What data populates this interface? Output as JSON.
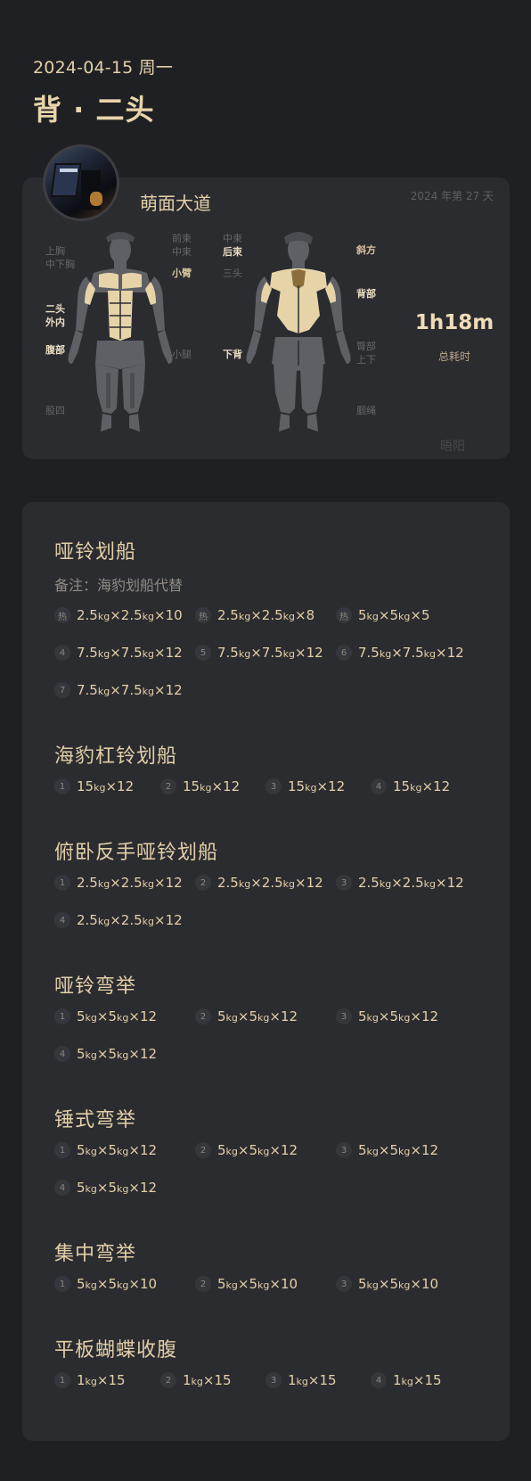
{
  "header": {
    "date": "2024-04-15 周一",
    "title": "背 · 二头"
  },
  "summary": {
    "user_name": "萌面大道",
    "day_count": "2024 年第 27 天",
    "duration": "1h18m",
    "duration_label": "总耗时",
    "watermark": "晤阳",
    "front_labels": [
      {
        "text": "上胸\n中下胸",
        "active": false
      },
      {
        "text": "二头\n外内",
        "active": true
      },
      {
        "text": "腹部",
        "active": true
      },
      {
        "text": "股四",
        "active": false
      },
      {
        "text": "前束\n中束",
        "active": false
      },
      {
        "text": "小臂",
        "active": true
      },
      {
        "text": "小腿",
        "active": false
      }
    ],
    "back_labels": [
      {
        "text": "中束",
        "active": false
      },
      {
        "text": "后束",
        "active": true
      },
      {
        "text": "三头",
        "active": false
      },
      {
        "text": "下背",
        "active": true
      },
      {
        "text": "斜方",
        "active": true
      },
      {
        "text": "背部",
        "active": true
      },
      {
        "text": "臀部\n上下",
        "active": false
      },
      {
        "text": "腘绳",
        "active": false
      }
    ],
    "colors": {
      "accent": "#d8c39e",
      "highlight": "#e6d3a8",
      "muscle": "#5e6066",
      "muscle_dark": "#4a4c52"
    }
  },
  "exercises": [
    {
      "name": "哑铃划船",
      "note": "备注：海豹划船代替",
      "sets": [
        {
          "badge": "热",
          "parts": [
            "2.5",
            "kg",
            "×",
            "2.5",
            "kg",
            "×10"
          ]
        },
        {
          "badge": "热",
          "parts": [
            "2.5",
            "kg",
            "×",
            "2.5",
            "kg",
            "×8"
          ]
        },
        {
          "badge": "热",
          "parts": [
            "5",
            "kg",
            "×",
            "5",
            "kg",
            "×5"
          ]
        },
        {
          "badge": "4",
          "parts": [
            "7.5",
            "kg",
            "×",
            "7.5",
            "kg",
            "×12"
          ]
        },
        {
          "badge": "5",
          "parts": [
            "7.5",
            "kg",
            "×",
            "7.5",
            "kg",
            "×12"
          ]
        },
        {
          "badge": "6",
          "parts": [
            "7.5",
            "kg",
            "×",
            "7.5",
            "kg",
            "×12"
          ]
        },
        {
          "badge": "7",
          "parts": [
            "7.5",
            "kg",
            "×",
            "7.5",
            "kg",
            "×12"
          ]
        }
      ]
    },
    {
      "name": "海豹杠铃划船",
      "note": "",
      "sets": [
        {
          "badge": "1",
          "parts": [
            "15",
            "kg",
            "×12"
          ]
        },
        {
          "badge": "2",
          "parts": [
            "15",
            "kg",
            "×12"
          ]
        },
        {
          "badge": "3",
          "parts": [
            "15",
            "kg",
            "×12"
          ]
        },
        {
          "badge": "4",
          "parts": [
            "15",
            "kg",
            "×12"
          ]
        }
      ]
    },
    {
      "name": "俯卧反手哑铃划船",
      "note": "",
      "sets": [
        {
          "badge": "1",
          "parts": [
            "2.5",
            "kg",
            "×",
            "2.5",
            "kg",
            "×12"
          ]
        },
        {
          "badge": "2",
          "parts": [
            "2.5",
            "kg",
            "×",
            "2.5",
            "kg",
            "×12"
          ]
        },
        {
          "badge": "3",
          "parts": [
            "2.5",
            "kg",
            "×",
            "2.5",
            "kg",
            "×12"
          ]
        },
        {
          "badge": "4",
          "parts": [
            "2.5",
            "kg",
            "×",
            "2.5",
            "kg",
            "×12"
          ]
        }
      ]
    },
    {
      "name": "哑铃弯举",
      "note": "",
      "sets": [
        {
          "badge": "1",
          "parts": [
            "5",
            "kg",
            "×",
            "5",
            "kg",
            "×12"
          ]
        },
        {
          "badge": "2",
          "parts": [
            "5",
            "kg",
            "×",
            "5",
            "kg",
            "×12"
          ]
        },
        {
          "badge": "3",
          "parts": [
            "5",
            "kg",
            "×",
            "5",
            "kg",
            "×12"
          ]
        },
        {
          "badge": "4",
          "parts": [
            "5",
            "kg",
            "×",
            "5",
            "kg",
            "×12"
          ]
        }
      ]
    },
    {
      "name": "锤式弯举",
      "note": "",
      "sets": [
        {
          "badge": "1",
          "parts": [
            "5",
            "kg",
            "×",
            "5",
            "kg",
            "×12"
          ]
        },
        {
          "badge": "2",
          "parts": [
            "5",
            "kg",
            "×",
            "5",
            "kg",
            "×12"
          ]
        },
        {
          "badge": "3",
          "parts": [
            "5",
            "kg",
            "×",
            "5",
            "kg",
            "×12"
          ]
        },
        {
          "badge": "4",
          "parts": [
            "5",
            "kg",
            "×",
            "5",
            "kg",
            "×12"
          ]
        }
      ]
    },
    {
      "name": "集中弯举",
      "note": "",
      "sets": [
        {
          "badge": "1",
          "parts": [
            "5",
            "kg",
            "×",
            "5",
            "kg",
            "×10"
          ]
        },
        {
          "badge": "2",
          "parts": [
            "5",
            "kg",
            "×",
            "5",
            "kg",
            "×10"
          ]
        },
        {
          "badge": "3",
          "parts": [
            "5",
            "kg",
            "×",
            "5",
            "kg",
            "×10"
          ]
        }
      ]
    },
    {
      "name": "平板蝴蝶收腹",
      "note": "",
      "sets": [
        {
          "badge": "1",
          "parts": [
            "1",
            "kg",
            "×15"
          ]
        },
        {
          "badge": "2",
          "parts": [
            "1",
            "kg",
            "×15"
          ]
        },
        {
          "badge": "3",
          "parts": [
            "1",
            "kg",
            "×15"
          ]
        },
        {
          "badge": "4",
          "parts": [
            "1",
            "kg",
            "×15"
          ]
        }
      ]
    }
  ]
}
